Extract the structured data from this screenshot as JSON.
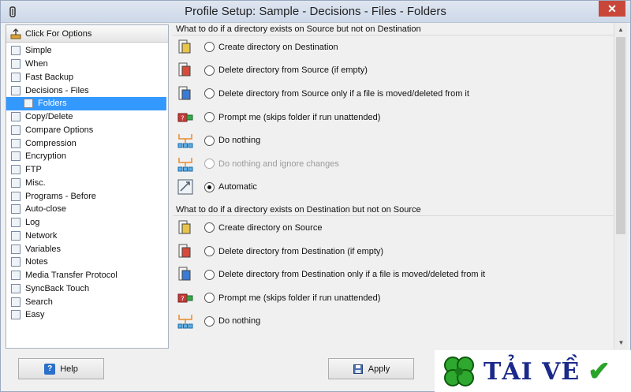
{
  "window": {
    "title": "Profile Setup: Sample - Decisions - Files - Folders",
    "close_glyph": "✕"
  },
  "sidebar": {
    "header_label": "Click For Options",
    "items": [
      {
        "label": "Simple",
        "icon": "simple-icon"
      },
      {
        "label": "When",
        "icon": "clock-icon"
      },
      {
        "label": "Fast Backup",
        "icon": "fast-backup-icon"
      },
      {
        "label": "Decisions - Files",
        "icon": "decisions-icon"
      },
      {
        "label": "Folders",
        "icon": "folder-icon",
        "child": true,
        "selected": true
      },
      {
        "label": "Copy/Delete",
        "icon": "copy-delete-icon"
      },
      {
        "label": "Compare Options",
        "icon": "compare-icon"
      },
      {
        "label": "Compression",
        "icon": "compression-icon"
      },
      {
        "label": "Encryption",
        "icon": "lock-icon"
      },
      {
        "label": "FTP",
        "icon": "ftp-icon"
      },
      {
        "label": "Misc.",
        "icon": "misc-icon"
      },
      {
        "label": "Programs - Before",
        "icon": "programs-icon"
      },
      {
        "label": "Auto-close",
        "icon": "auto-close-icon"
      },
      {
        "label": "Log",
        "icon": "log-icon"
      },
      {
        "label": "Network",
        "icon": "network-icon"
      },
      {
        "label": "Variables",
        "icon": "variables-icon"
      },
      {
        "label": "Notes",
        "icon": "notes-icon"
      },
      {
        "label": "Media Transfer Protocol",
        "icon": "mtp-icon"
      },
      {
        "label": "SyncBack Touch",
        "icon": "touch-icon"
      },
      {
        "label": "Search",
        "icon": "search-icon"
      },
      {
        "label": "Easy",
        "icon": "easy-icon"
      }
    ]
  },
  "section1": {
    "title": "What to do if a directory exists on Source but not on Destination",
    "options": [
      {
        "label": "Create directory on Destination",
        "checked": false,
        "disabled": false
      },
      {
        "label": "Delete directory from Source (if empty)",
        "checked": false,
        "disabled": false
      },
      {
        "label": "Delete directory from Source only if a file is moved/deleted from it",
        "checked": false,
        "disabled": false
      },
      {
        "label": "Prompt me (skips folder if run unattended)",
        "checked": false,
        "disabled": false
      },
      {
        "label": "Do nothing",
        "checked": false,
        "disabled": false
      },
      {
        "label": "Do nothing and ignore changes",
        "checked": false,
        "disabled": true
      },
      {
        "label": "Automatic",
        "checked": true,
        "disabled": false
      }
    ]
  },
  "section2": {
    "title": "What to do if a directory exists on Destination but not on Source",
    "options": [
      {
        "label": "Create directory on Source",
        "checked": false,
        "disabled": false
      },
      {
        "label": "Delete directory from Destination (if empty)",
        "checked": false,
        "disabled": false
      },
      {
        "label": "Delete directory from Destination only if a file is moved/deleted from it",
        "checked": false,
        "disabled": false
      },
      {
        "label": "Prompt me (skips folder if run unattended)",
        "checked": false,
        "disabled": false
      },
      {
        "label": "Do nothing",
        "checked": false,
        "disabled": false
      }
    ]
  },
  "buttons": {
    "help": "Help",
    "apply": "Apply"
  },
  "watermark": {
    "text": "TẢI VỀ"
  },
  "colors": {
    "selection": "#3399ff",
    "close": "#c9473a",
    "watermark_text": "#1b2a8a",
    "clover": "#2ea82e"
  }
}
